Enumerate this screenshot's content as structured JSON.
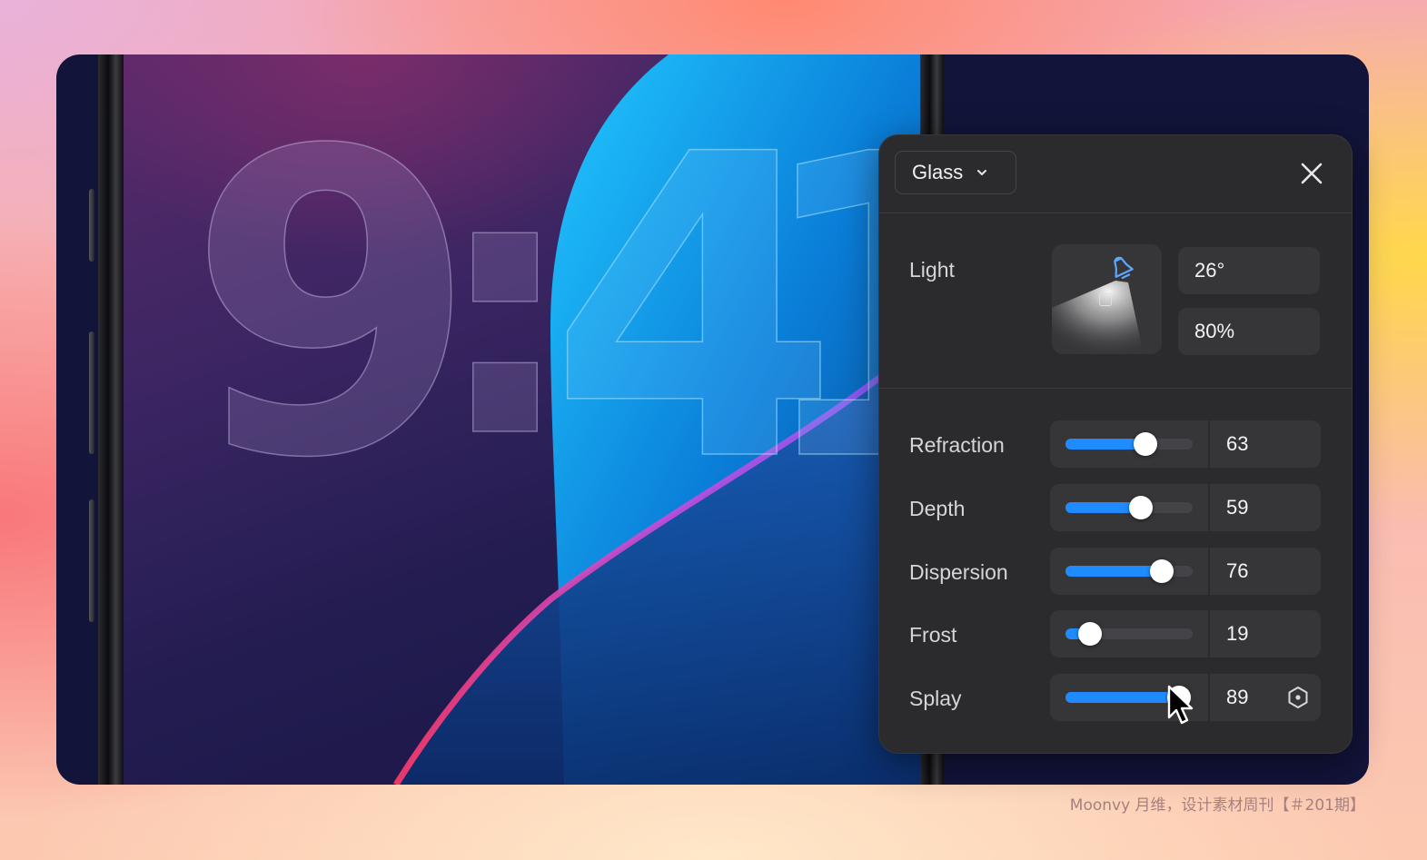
{
  "clock": {
    "hour": "9",
    "colon": ":",
    "minute_tens": "4",
    "minute_ones": "1"
  },
  "panel": {
    "material_dropdown": {
      "selected": "Glass"
    },
    "light": {
      "label": "Light",
      "angle": "26°",
      "intensity": "80%"
    },
    "sliders": [
      {
        "label": "Refraction",
        "value": "63",
        "level": 63
      },
      {
        "label": "Depth",
        "value": "59",
        "level": 59
      },
      {
        "label": "Dispersion",
        "value": "76",
        "level": 76
      },
      {
        "label": "Frost",
        "value": "19",
        "level": 19
      },
      {
        "label": "Splay",
        "value": "89",
        "level": 89
      }
    ],
    "accent_color": "#1f8bff"
  },
  "footer": {
    "credit": "Moonvy 月维，设计素材周刊【＃201期】"
  }
}
